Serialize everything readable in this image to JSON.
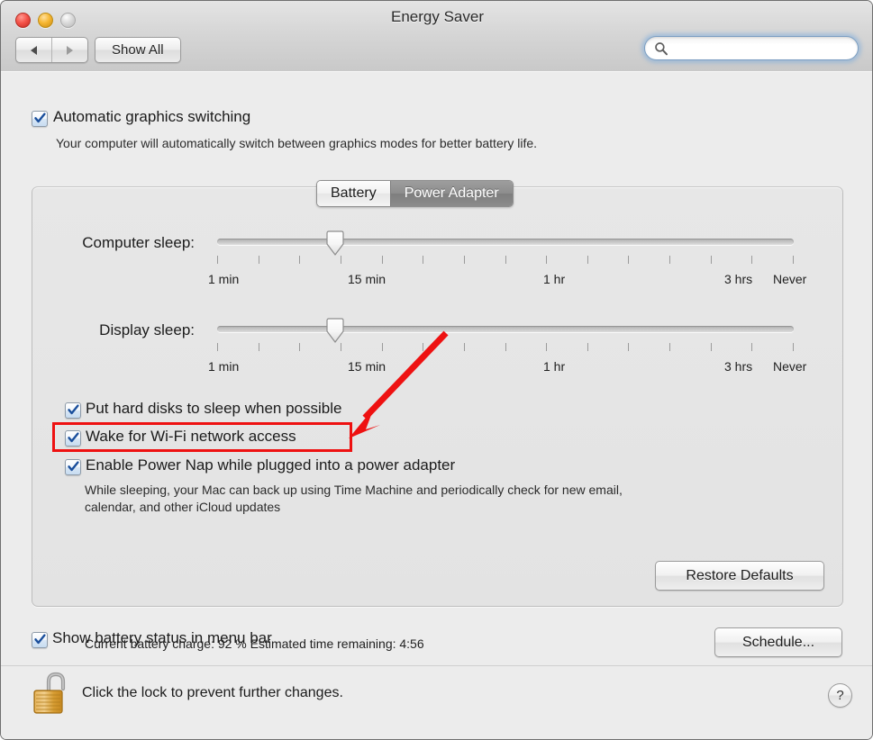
{
  "window": {
    "title": "Energy Saver",
    "traffic_lights": [
      {
        "name": "close",
        "color": "#f5544a"
      },
      {
        "name": "minimize",
        "color": "#f6b733"
      },
      {
        "name": "zoom",
        "color": "#dadada"
      }
    ]
  },
  "toolbar": {
    "back_icon": "triangle-left-icon",
    "forward_icon": "triangle-right-icon",
    "show_all_label": "Show All",
    "search": {
      "icon": "search-icon",
      "value": "",
      "placeholder": ""
    }
  },
  "top_option": {
    "checked": true,
    "label": "Automatic graphics switching",
    "description": "Your computer will automatically switch between graphics modes for better battery life."
  },
  "tabs": [
    {
      "label": "Battery",
      "selected": true
    },
    {
      "label": "Power Adapter",
      "selected": false
    }
  ],
  "sliders": [
    {
      "label": "Computer sleep:",
      "value_label": "15 min",
      "tick_labels": [
        "1 min",
        "15 min",
        "1 hr",
        "3 hrs",
        "Never"
      ],
      "tick_count": 15,
      "thumb_percent": 21
    },
    {
      "label": "Display sleep:",
      "value_label": "15 min",
      "tick_labels": [
        "1 min",
        "15 min",
        "1 hr",
        "3 hrs",
        "Never"
      ],
      "tick_count": 15,
      "thumb_percent": 21
    }
  ],
  "checkboxes": [
    {
      "label": "Put hard disks to sleep when possible",
      "checked": true
    },
    {
      "label": "Wake for Wi-Fi network access",
      "checked": true,
      "highlighted": true
    },
    {
      "label": "Enable Power Nap while plugged into a power adapter",
      "checked": true
    }
  ],
  "power_nap_description_line1": "While sleeping, your Mac can back up using Time Machine and periodically check for new email,",
  "power_nap_description_line2": "calendar, and other iCloud updates",
  "status": {
    "text": "Current battery charge: 92 %  Estimated time remaining: 4:56",
    "battery_charge": "92 %",
    "time_remaining": "4:56"
  },
  "restore_defaults_label": "Restore Defaults",
  "menu_bar_option": {
    "checked": true,
    "label": "Show battery status in menu bar"
  },
  "schedule_label": "Schedule...",
  "footer": {
    "lock_icon": "open-padlock-icon",
    "lock_text": "Click the lock to prevent further changes.",
    "help_label": "?"
  },
  "annotation": {
    "color": "#ee1111",
    "arrow": "red-arrow-pointing-to-wifi-checkbox",
    "box": "red-highlight-rectangle"
  }
}
